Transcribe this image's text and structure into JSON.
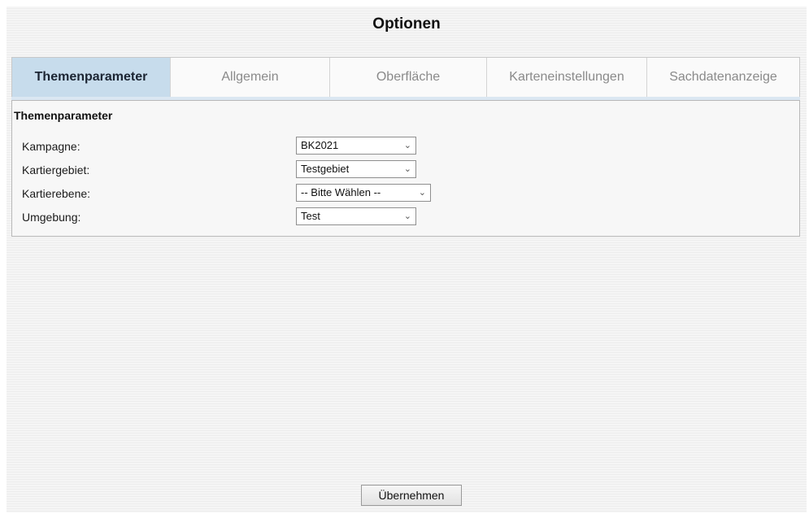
{
  "dialog": {
    "title": "Optionen"
  },
  "tabs": [
    {
      "label": "Themenparameter",
      "active": true
    },
    {
      "label": "Allgemein",
      "active": false
    },
    {
      "label": "Oberfläche",
      "active": false
    },
    {
      "label": "Karteneinstellungen",
      "active": false
    },
    {
      "label": "Sachdatenanzeige",
      "active": false
    }
  ],
  "panel": {
    "title": "Themenparameter",
    "fields": [
      {
        "label": "Kampagne:",
        "value": "BK2021"
      },
      {
        "label": "Kartiergebiet:",
        "value": "Testgebiet"
      },
      {
        "label": "Kartierebene:",
        "value": "-- Bitte Wählen --"
      },
      {
        "label": "Umgebung:",
        "value": "Test"
      }
    ]
  },
  "footer": {
    "apply_label": "Übernehmen"
  },
  "colors": {
    "active_tab_bg": "#c7dcec",
    "inactive_tab_text": "#8a8a8a"
  },
  "icons": {
    "select_chevron": "chevron-down-icon"
  }
}
